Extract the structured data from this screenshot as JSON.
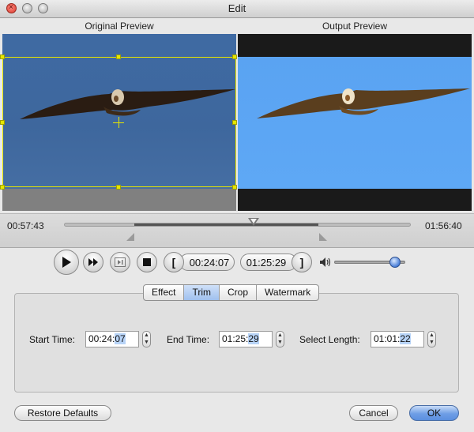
{
  "window": {
    "title": "Edit"
  },
  "previews": {
    "original_label": "Original Preview",
    "output_label": "Output Preview"
  },
  "timeline": {
    "current_time": "00:57:43",
    "total_time": "01:56:40"
  },
  "controls": {
    "start_time_display": "00:24:07",
    "end_time_display": "01:25:29",
    "volume_level": 0.85,
    "icons": [
      "play-icon",
      "fast-forward-icon",
      "step-frame-icon",
      "stop-icon",
      "set-start-bracket-icon",
      "set-end-bracket-icon",
      "speaker-icon"
    ],
    "set_start_symbol": "[",
    "set_end_symbol": "]"
  },
  "tabs": [
    {
      "label": "Effect",
      "active": false
    },
    {
      "label": "Trim",
      "active": true
    },
    {
      "label": "Crop",
      "active": false
    },
    {
      "label": "Watermark",
      "active": false
    }
  ],
  "trim": {
    "start": {
      "label": "Start Time:",
      "prefix": "00:24:",
      "selected": "07"
    },
    "end": {
      "label": "End Time:",
      "prefix": "01:25:",
      "selected": "29"
    },
    "length": {
      "label": "Select Length:",
      "prefix": "01:01:",
      "selected": "22"
    }
  },
  "buttons": {
    "restore": "Restore Defaults",
    "cancel": "Cancel",
    "ok": "OK"
  },
  "colors": {
    "crop_border": "#e6e600",
    "selection": "#b7d3f7",
    "primary_button": "#6e9ee6"
  }
}
